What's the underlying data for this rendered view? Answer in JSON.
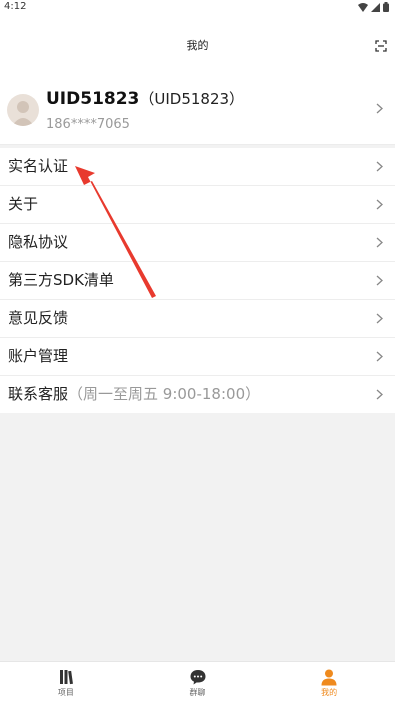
{
  "status_bar": {
    "time": "4:12"
  },
  "header": {
    "title": "我的"
  },
  "profile": {
    "name": "UID51823",
    "name_paren": "（UID51823）",
    "phone": "186****7065"
  },
  "menu": {
    "items": [
      {
        "label": "实名认证",
        "sub": ""
      },
      {
        "label": "关于",
        "sub": ""
      },
      {
        "label": "隐私协议",
        "sub": ""
      },
      {
        "label": "第三方SDK清单",
        "sub": ""
      },
      {
        "label": "意见反馈",
        "sub": ""
      },
      {
        "label": "账户管理",
        "sub": ""
      },
      {
        "label": "联系客服",
        "sub": "（周一至周五 9:00-18:00）"
      }
    ]
  },
  "tabbar": {
    "tabs": [
      {
        "label": "项目",
        "icon": "projects-icon"
      },
      {
        "label": "群聊",
        "icon": "chat-icon"
      },
      {
        "label": "我的",
        "icon": "person-icon"
      }
    ]
  },
  "colors": {
    "accent": "#ef8a1e",
    "annotation": "#e83a2e"
  }
}
